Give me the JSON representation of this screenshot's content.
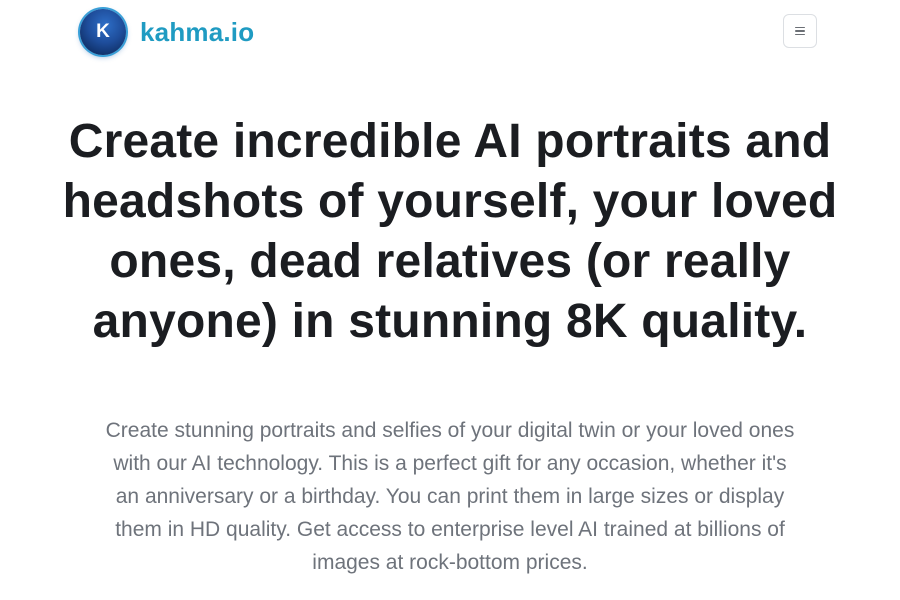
{
  "header": {
    "logo_letter": "K",
    "brand_name": "kahma.io",
    "menu_icon": "hamburger-menu-icon"
  },
  "hero": {
    "title": "Create incredible AI portraits and headshots of yourself, your loved ones, dead relatives (or really anyone) in stunning 8K quality.",
    "description": "Create stunning portraits and selfies of your digital twin or your loved ones with our AI technology. This is a perfect gift for any occasion, whether it's an anniversary or a birthday. You can print them in large sizes or display them in HD quality. Get access to enterprise level AI trained at billions of images at rock-bottom prices."
  },
  "colors": {
    "brand": "#1f9bc2",
    "logo_bg": "#1e4d9b",
    "title_text": "#1b1d21",
    "body_text": "#6e737b"
  }
}
